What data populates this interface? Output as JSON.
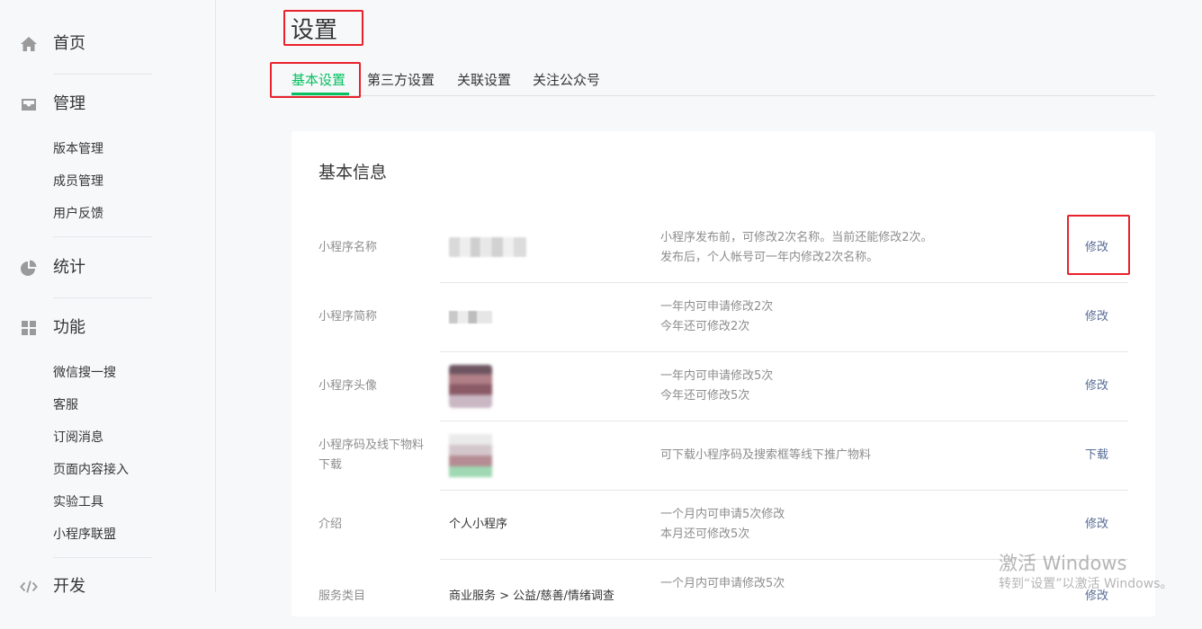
{
  "sidebar": {
    "home": {
      "label": "首页",
      "icon": "home-icon"
    },
    "manage": {
      "label": "管理",
      "icon": "inbox-icon",
      "items": [
        "版本管理",
        "成员管理",
        "用户反馈"
      ]
    },
    "stats": {
      "label": "统计",
      "icon": "pie-chart-icon"
    },
    "features": {
      "label": "功能",
      "icon": "grid-icon",
      "items": [
        "微信搜一搜",
        "客服",
        "订阅消息",
        "页面内容接入",
        "实验工具",
        "小程序联盟"
      ]
    },
    "develop": {
      "label": "开发",
      "icon": "code-icon"
    }
  },
  "header": {
    "title": "设置"
  },
  "tabs": [
    {
      "label": "基本设置",
      "active": true
    },
    {
      "label": "第三方设置",
      "active": false
    },
    {
      "label": "关联设置",
      "active": false
    },
    {
      "label": "关注公众号",
      "active": false
    }
  ],
  "card": {
    "title": "基本信息",
    "rows": [
      {
        "label": "小程序名称",
        "value": "",
        "desc": [
          "小程序发布前，可修改2次名称。当前还能修改2次。",
          "发布后，个人帐号可一年内修改2次名称。"
        ],
        "action": "修改"
      },
      {
        "label": "小程序简称",
        "value": "",
        "desc": [
          "一年内可申请修改2次",
          "今年还可修改2次"
        ],
        "action": "修改"
      },
      {
        "label": "小程序头像",
        "value": "",
        "desc": [
          "一年内可申请修改5次",
          "今年还可修改5次"
        ],
        "action": "修改"
      },
      {
        "label": "小程序码及线下物料下载",
        "value": "",
        "desc": [
          "可下载小程序码及搜索框等线下推广物料"
        ],
        "action": "下载"
      },
      {
        "label": "介绍",
        "value": "个人小程序",
        "desc": [
          "一个月内可申请5次修改",
          "本月还可修改5次"
        ],
        "action": "修改"
      },
      {
        "label": "服务类目",
        "value": "商业服务 > 公益/慈善/情绪调查",
        "desc": [
          "一个月内可申请修改5次"
        ],
        "action": "修改"
      }
    ]
  },
  "watermark": {
    "line1": "激活 Windows",
    "line2": "转到“设置”以激活 Windows。"
  },
  "colors": {
    "accent": "#07c160",
    "link": "#576b95",
    "annotation": "#e8212b"
  }
}
